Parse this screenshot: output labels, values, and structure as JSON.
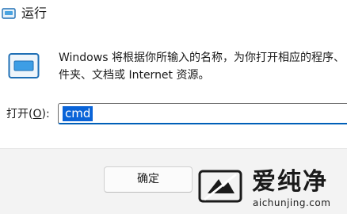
{
  "window": {
    "title": "运行",
    "app_icon": "run-dialog-icon"
  },
  "main": {
    "icon": "run-program-icon",
    "description": "Windows 将根据你所输入的名称，为你打开相应的程序、\n件夹、文档或 Internet 资源。"
  },
  "open_field": {
    "label_prefix": "打开(",
    "label_accel": "O",
    "label_suffix": "):",
    "value": "cmd"
  },
  "buttons": {
    "ok": "确定"
  },
  "watermark": {
    "text": "爱纯净",
    "url": "aichunjing.com",
    "logo": "aichunjing-logo"
  },
  "colors": {
    "accent": "#005fb8",
    "selection": "#0a64d8",
    "footer_bg": "#f3f3f3"
  }
}
